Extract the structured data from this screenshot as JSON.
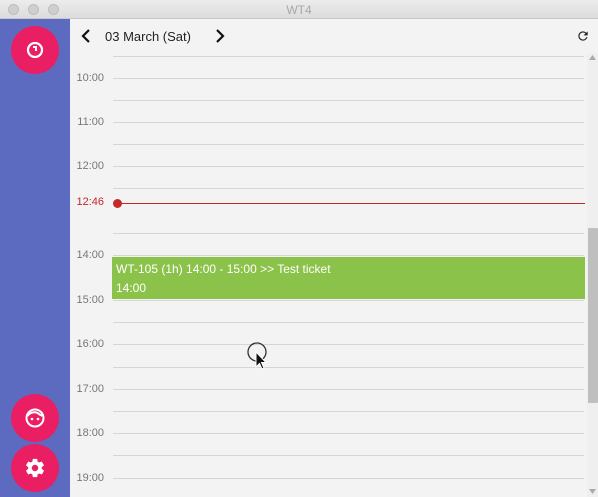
{
  "window": {
    "title": "WT4"
  },
  "header": {
    "date": "03 March (Sat)"
  },
  "timeline": {
    "hours": [
      "10:00",
      "11:00",
      "12:00",
      "14:00",
      "15:00",
      "16:00",
      "17:00",
      "18:00",
      "19:00"
    ],
    "now_label": "12:46"
  },
  "event": {
    "title": "WT-105 (1h) 14:00 - 15:00 >> Test ticket",
    "subtitle": "14:00",
    "color": "#8bc34a"
  },
  "colors": {
    "sidebar": "#5c6bc0",
    "accent": "#e91e63",
    "now": "#c62828"
  },
  "icons": {
    "top_fab": "timer-icon",
    "user_fab": "face-icon",
    "settings_fab": "gear-icon"
  }
}
